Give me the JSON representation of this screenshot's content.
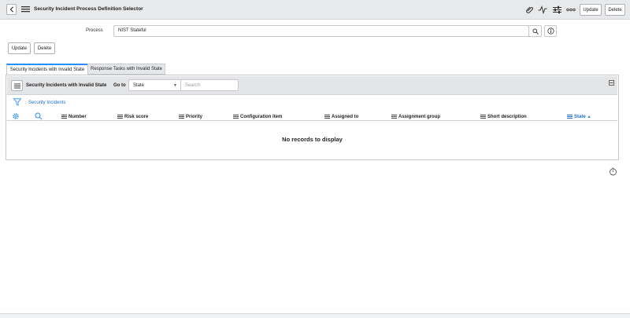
{
  "header": {
    "title": "Security Incident Process Definition Selector",
    "icons": [
      "back-icon",
      "hamburger-icon",
      "attachment-icon",
      "activity-icon",
      "settings-sliders-icon",
      "more-icon"
    ],
    "update_label": "Update",
    "delete_label": "Delete"
  },
  "form": {
    "process_label": "Process",
    "process_value": "NIST Stateful",
    "update_label": "Update",
    "delete_label": "Delete"
  },
  "tabs": [
    {
      "label": "Security Incidents with Invalid State",
      "active": true
    },
    {
      "label": "Response Tasks with Invalid State",
      "active": false
    }
  ],
  "list": {
    "title": "Security Incidents with Invalid State",
    "goto_label": "Go to",
    "goto_selected": "State",
    "search_placeholder": "Search",
    "breadcrumb": "Security Incidents",
    "columns": [
      {
        "label": "Number"
      },
      {
        "label": "Risk score"
      },
      {
        "label": "Priority"
      },
      {
        "label": "Configuration item"
      },
      {
        "label": "Assigned to"
      },
      {
        "label": "Assignment group"
      },
      {
        "label": "Short description"
      },
      {
        "label": "State",
        "sorted": "ascending"
      }
    ],
    "sort_indicator": "▲",
    "empty_message": "No records to display"
  },
  "colors": {
    "accent": "#278efc",
    "link": "#1f6fc7",
    "header_bg": "#e8e9eb"
  }
}
